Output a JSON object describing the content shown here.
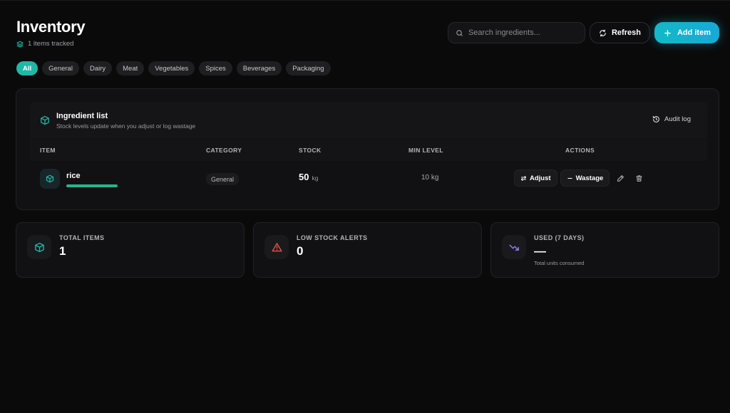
{
  "header": {
    "title": "Inventory",
    "subtitle": "1 items tracked"
  },
  "search": {
    "placeholder": "Search ingredients...",
    "value": ""
  },
  "toolbar": {
    "refresh_label": "Refresh",
    "add_label": "Add item"
  },
  "filters": [
    "All",
    "General",
    "Dairy",
    "Meat",
    "Vegetables",
    "Spices",
    "Beverages",
    "Packaging"
  ],
  "active_filter": "All",
  "panel": {
    "title": "Ingredient list",
    "subtitle": "Stock levels update when you adjust or log wastage",
    "audit_label": "Audit log"
  },
  "table": {
    "columns": [
      "ITEM",
      "CATEGORY",
      "STOCK",
      "MIN LEVEL",
      "ACTIONS"
    ],
    "rows": [
      {
        "name": "rice",
        "category": "General",
        "stock_value": "50",
        "stock_unit": "kg",
        "min_level": "10 kg",
        "adjust_label": "Adjust",
        "wastage_label": "Wastage"
      }
    ]
  },
  "stats": [
    {
      "label": "TOTAL ITEMS",
      "value": "1",
      "note": "",
      "icon": "cube-icon"
    },
    {
      "label": "LOW STOCK ALERTS",
      "value": "0",
      "note": "",
      "icon": "alert-triangle-icon"
    },
    {
      "label": "USED (7 DAYS)",
      "value": "—",
      "note": "Total units consumed",
      "icon": "trending-down-icon"
    }
  ],
  "colors": {
    "accent_teal": "#1fb8a6",
    "add_button": "#17a9d6",
    "alert_red": "#e5534b",
    "used_purple": "#8b7cf0",
    "stock_bar": "#1fb88c"
  }
}
